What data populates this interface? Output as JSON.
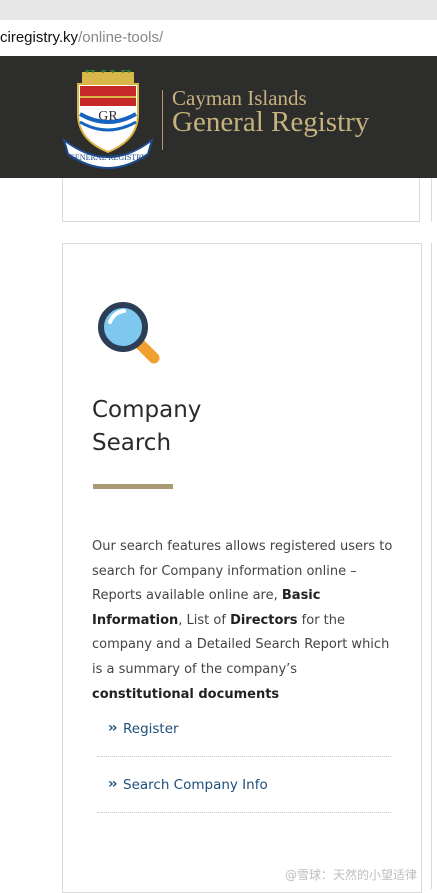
{
  "browser": {
    "url_host": "ciregistry.ky",
    "url_path": "/online-tools/"
  },
  "header": {
    "brand_line1": "Cayman Islands",
    "brand_line2": "General Registry",
    "crest_label": "GENERAL REGISTRY",
    "crest_initials": "GR"
  },
  "card": {
    "title_line1": "Company",
    "title_line2": "Search",
    "description": [
      {
        "text": "Our search features allows registered users to search for Company information online – Reports available online are, "
      },
      {
        "text": "Basic Information",
        "bold": true
      },
      {
        "text": ", List of "
      },
      {
        "text": "Directors",
        "bold": true
      },
      {
        "text": " for the company and a Detailed Search Report which is a summary of the company’s "
      },
      {
        "text": "constitutional documents",
        "bold": true
      }
    ],
    "links": [
      {
        "label": "Register",
        "icon": "double-chevron-right-icon"
      },
      {
        "label": "Search Company Info",
        "icon": "double-chevron-right-icon"
      }
    ]
  },
  "watermark": "@雪球：天然的小望适律",
  "colors": {
    "header_bg": "#2d2d2c",
    "gold": "#c7b27f",
    "link": "#1f4e79",
    "underline": "#aa9a73"
  }
}
